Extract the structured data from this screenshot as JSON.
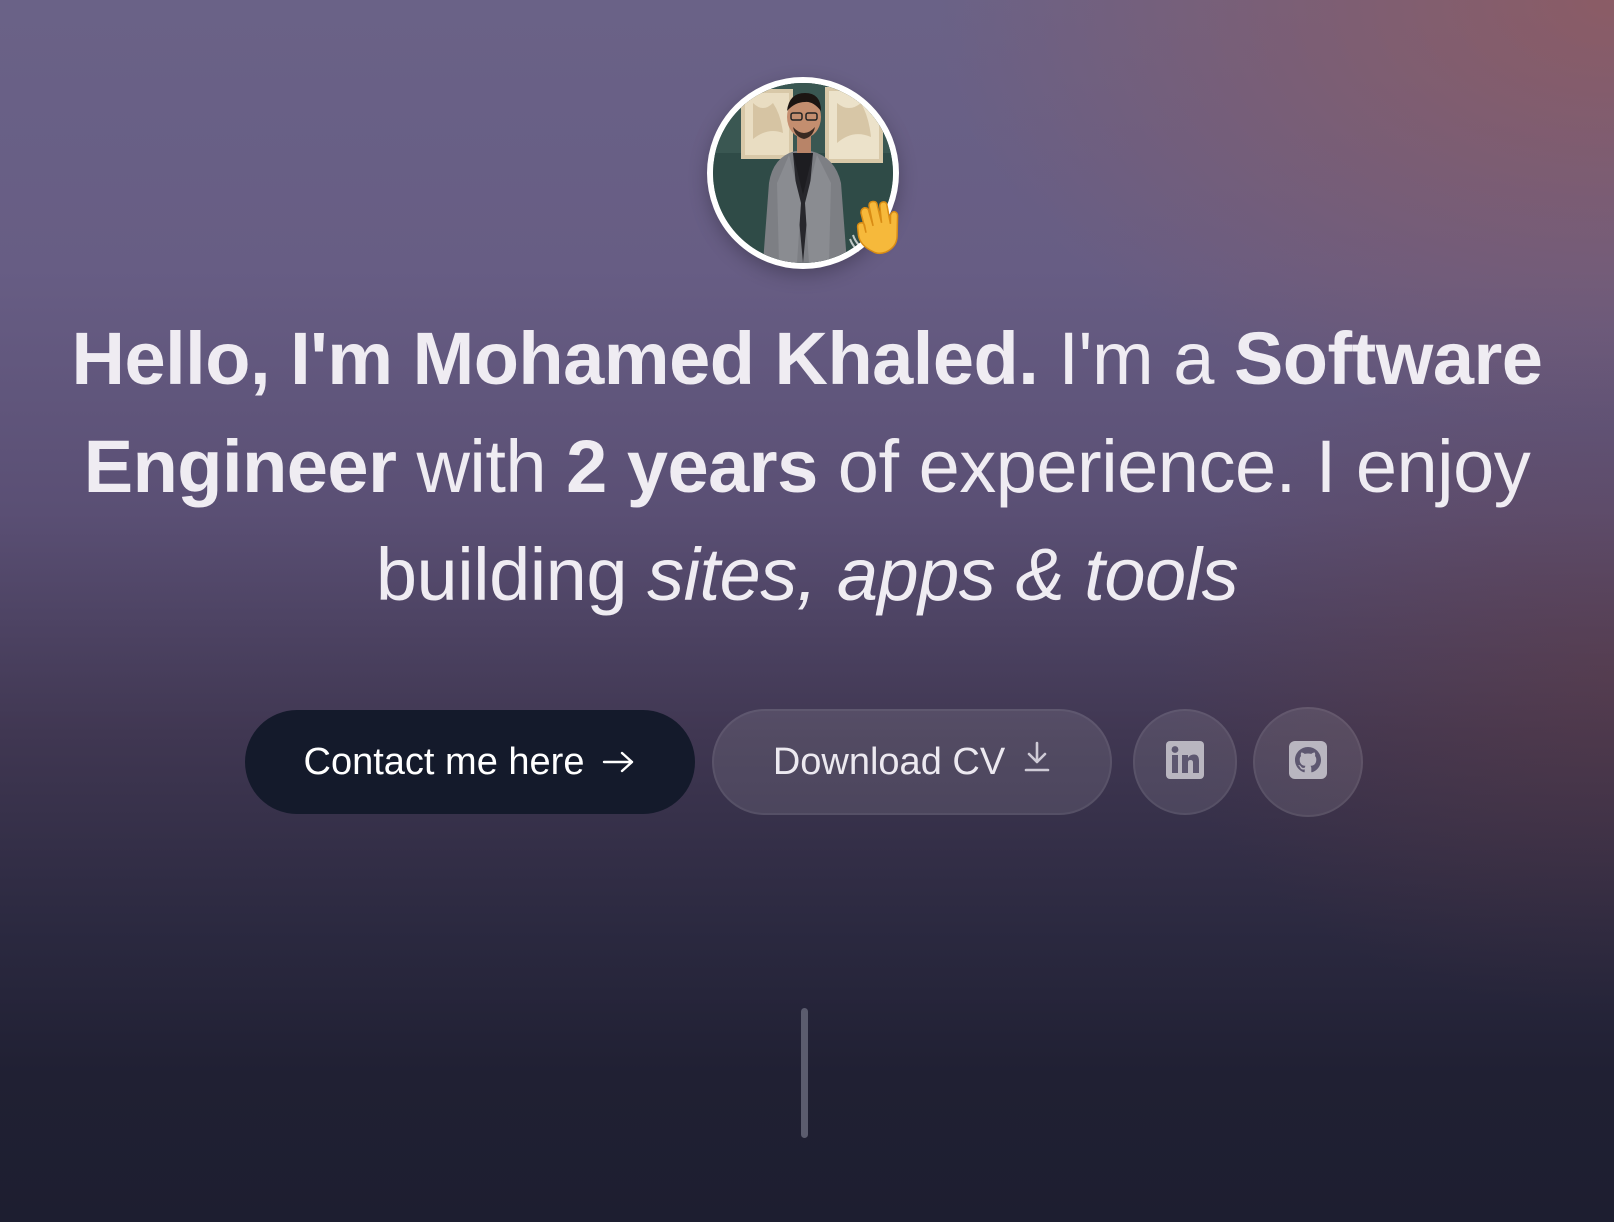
{
  "hero": {
    "avatar_alt": "Mohamed Khaled",
    "wave_emoji": "👋",
    "headline": {
      "part1": "Hello, I'm Mohamed Khaled.",
      "part2": " I'm a ",
      "part3": "Software Engineer",
      "part4": " with ",
      "part5": "2 years",
      "part6": " of experience. I enjoy building ",
      "part7": "sites, apps & tools"
    }
  },
  "actions": {
    "contact_label": "Contact me here",
    "contact_icon": "arrow-right-icon",
    "download_label": "Download CV",
    "download_icon": "download-icon",
    "linkedin_icon": "linkedin-icon",
    "github_icon": "github-icon"
  },
  "colors": {
    "primary_button": "#141a2b",
    "text": "#efecf2"
  }
}
